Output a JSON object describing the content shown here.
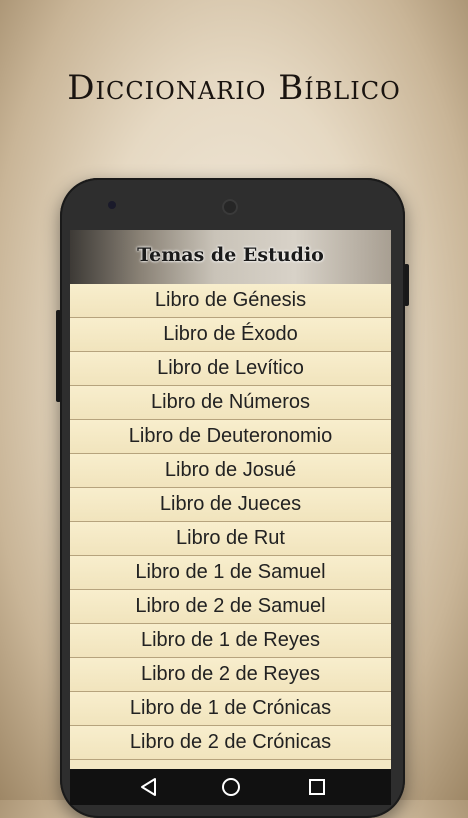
{
  "promo": {
    "title": "Diccionario Bíblico"
  },
  "app": {
    "header_title": "Temas de Estudio"
  },
  "list": {
    "items": [
      "Libro de Génesis",
      "Libro de Éxodo",
      "Libro de Levítico",
      "Libro de Números",
      "Libro de Deuteronomio",
      "Libro de Josué",
      "Libro de Jueces",
      "Libro de Rut",
      "Libro de 1 de Samuel",
      "Libro de 2 de Samuel",
      "Libro de 1 de Reyes",
      "Libro de 2 de Reyes",
      "Libro de 1 de Crónicas",
      "Libro de 2 de Crónicas"
    ]
  },
  "navbar": {
    "back_icon": "back-triangle-icon",
    "home_icon": "home-circle-icon",
    "recents_icon": "recents-square-icon"
  },
  "colors": {
    "list_bg": "#f3e8c4",
    "divider": "#b6a37d",
    "phone_body": "#2e2e2e"
  }
}
